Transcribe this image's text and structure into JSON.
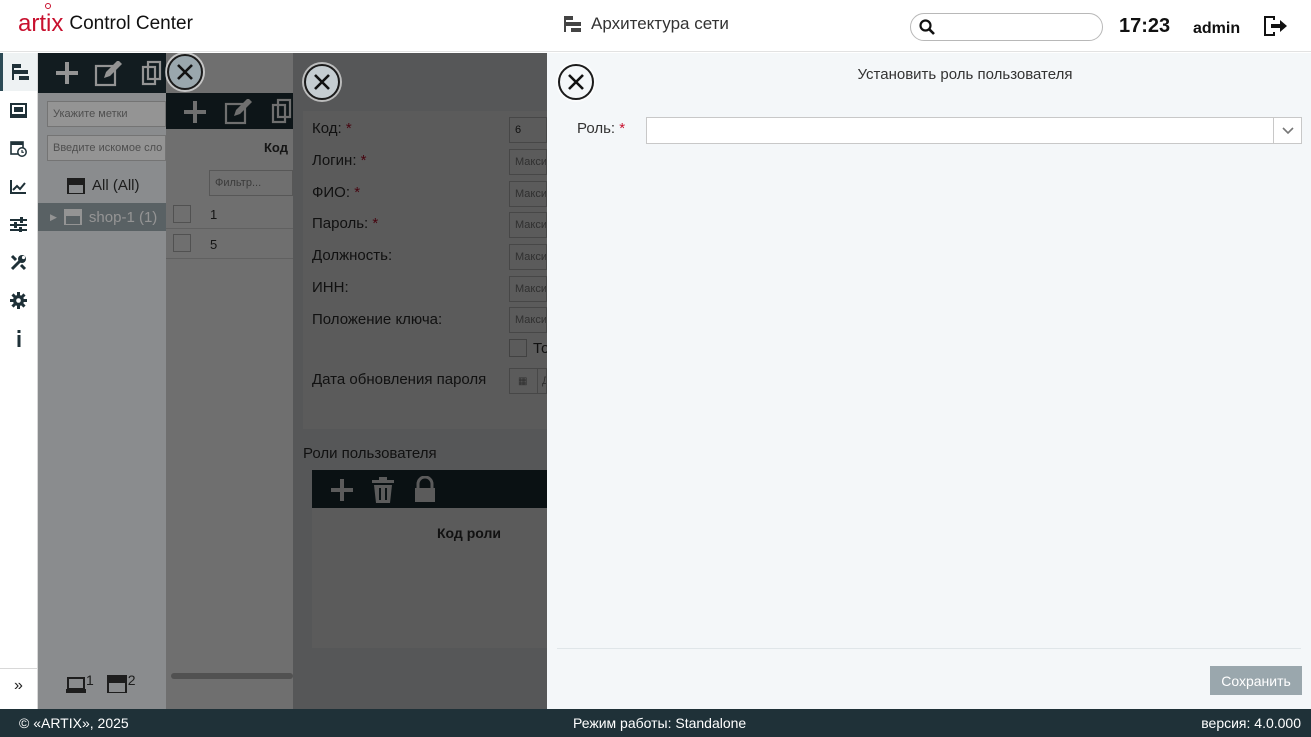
{
  "header": {
    "logo_brand": "art x",
    "logo_product": "Control Center",
    "section_title": "Архитектура сети",
    "search_placeholder": "",
    "clock": "17:23",
    "user": "admin"
  },
  "sidebar": {
    "items": [
      "network-tree-icon",
      "cash-register-icon",
      "calendar-clock-icon",
      "chart-icon",
      "sliders-icon",
      "tools-icon",
      "gear-icon",
      "info-icon"
    ],
    "expand_label": "»"
  },
  "left_panel": {
    "tags_placeholder": "Укажите метки",
    "search_placeholder": "Введите искомое сло",
    "tree_all": "All (All)",
    "tree_shop": "shop-1 (1)",
    "bottom_count_1": "1",
    "bottom_count_2": "2"
  },
  "users_list": {
    "column_code": "Код",
    "filter_placeholder": "Фильтр...",
    "rows": [
      "1",
      "5"
    ]
  },
  "user_form": {
    "code_label": "Код:",
    "code_value": "6",
    "login_label": "Логин:",
    "fio_label": "ФИО:",
    "password_label": "Пароль:",
    "position_label": "Должность:",
    "inn_label": "ИНН:",
    "key_label": "Положение ключа:",
    "checkbox_label": "То",
    "date_label": "Дата обновления пароля",
    "date_placeholder": "Д",
    "max_placeholder": "Макси",
    "roles_title": "Роли пользователя",
    "roles_column": "Код роли"
  },
  "dialog": {
    "title": "Установить роль пользователя",
    "role_label": "Роль:",
    "role_value": "",
    "save_label": "Сохранить"
  },
  "footer": {
    "copyright": "© «ARTIX», 2025",
    "mode": "Режим работы: Standalone",
    "version": "версия: 4.0.000"
  },
  "colors": {
    "brand_red": "#c8102e",
    "dark_toolbar": "#1f3138",
    "save_disabled": "#9aa7ad"
  }
}
